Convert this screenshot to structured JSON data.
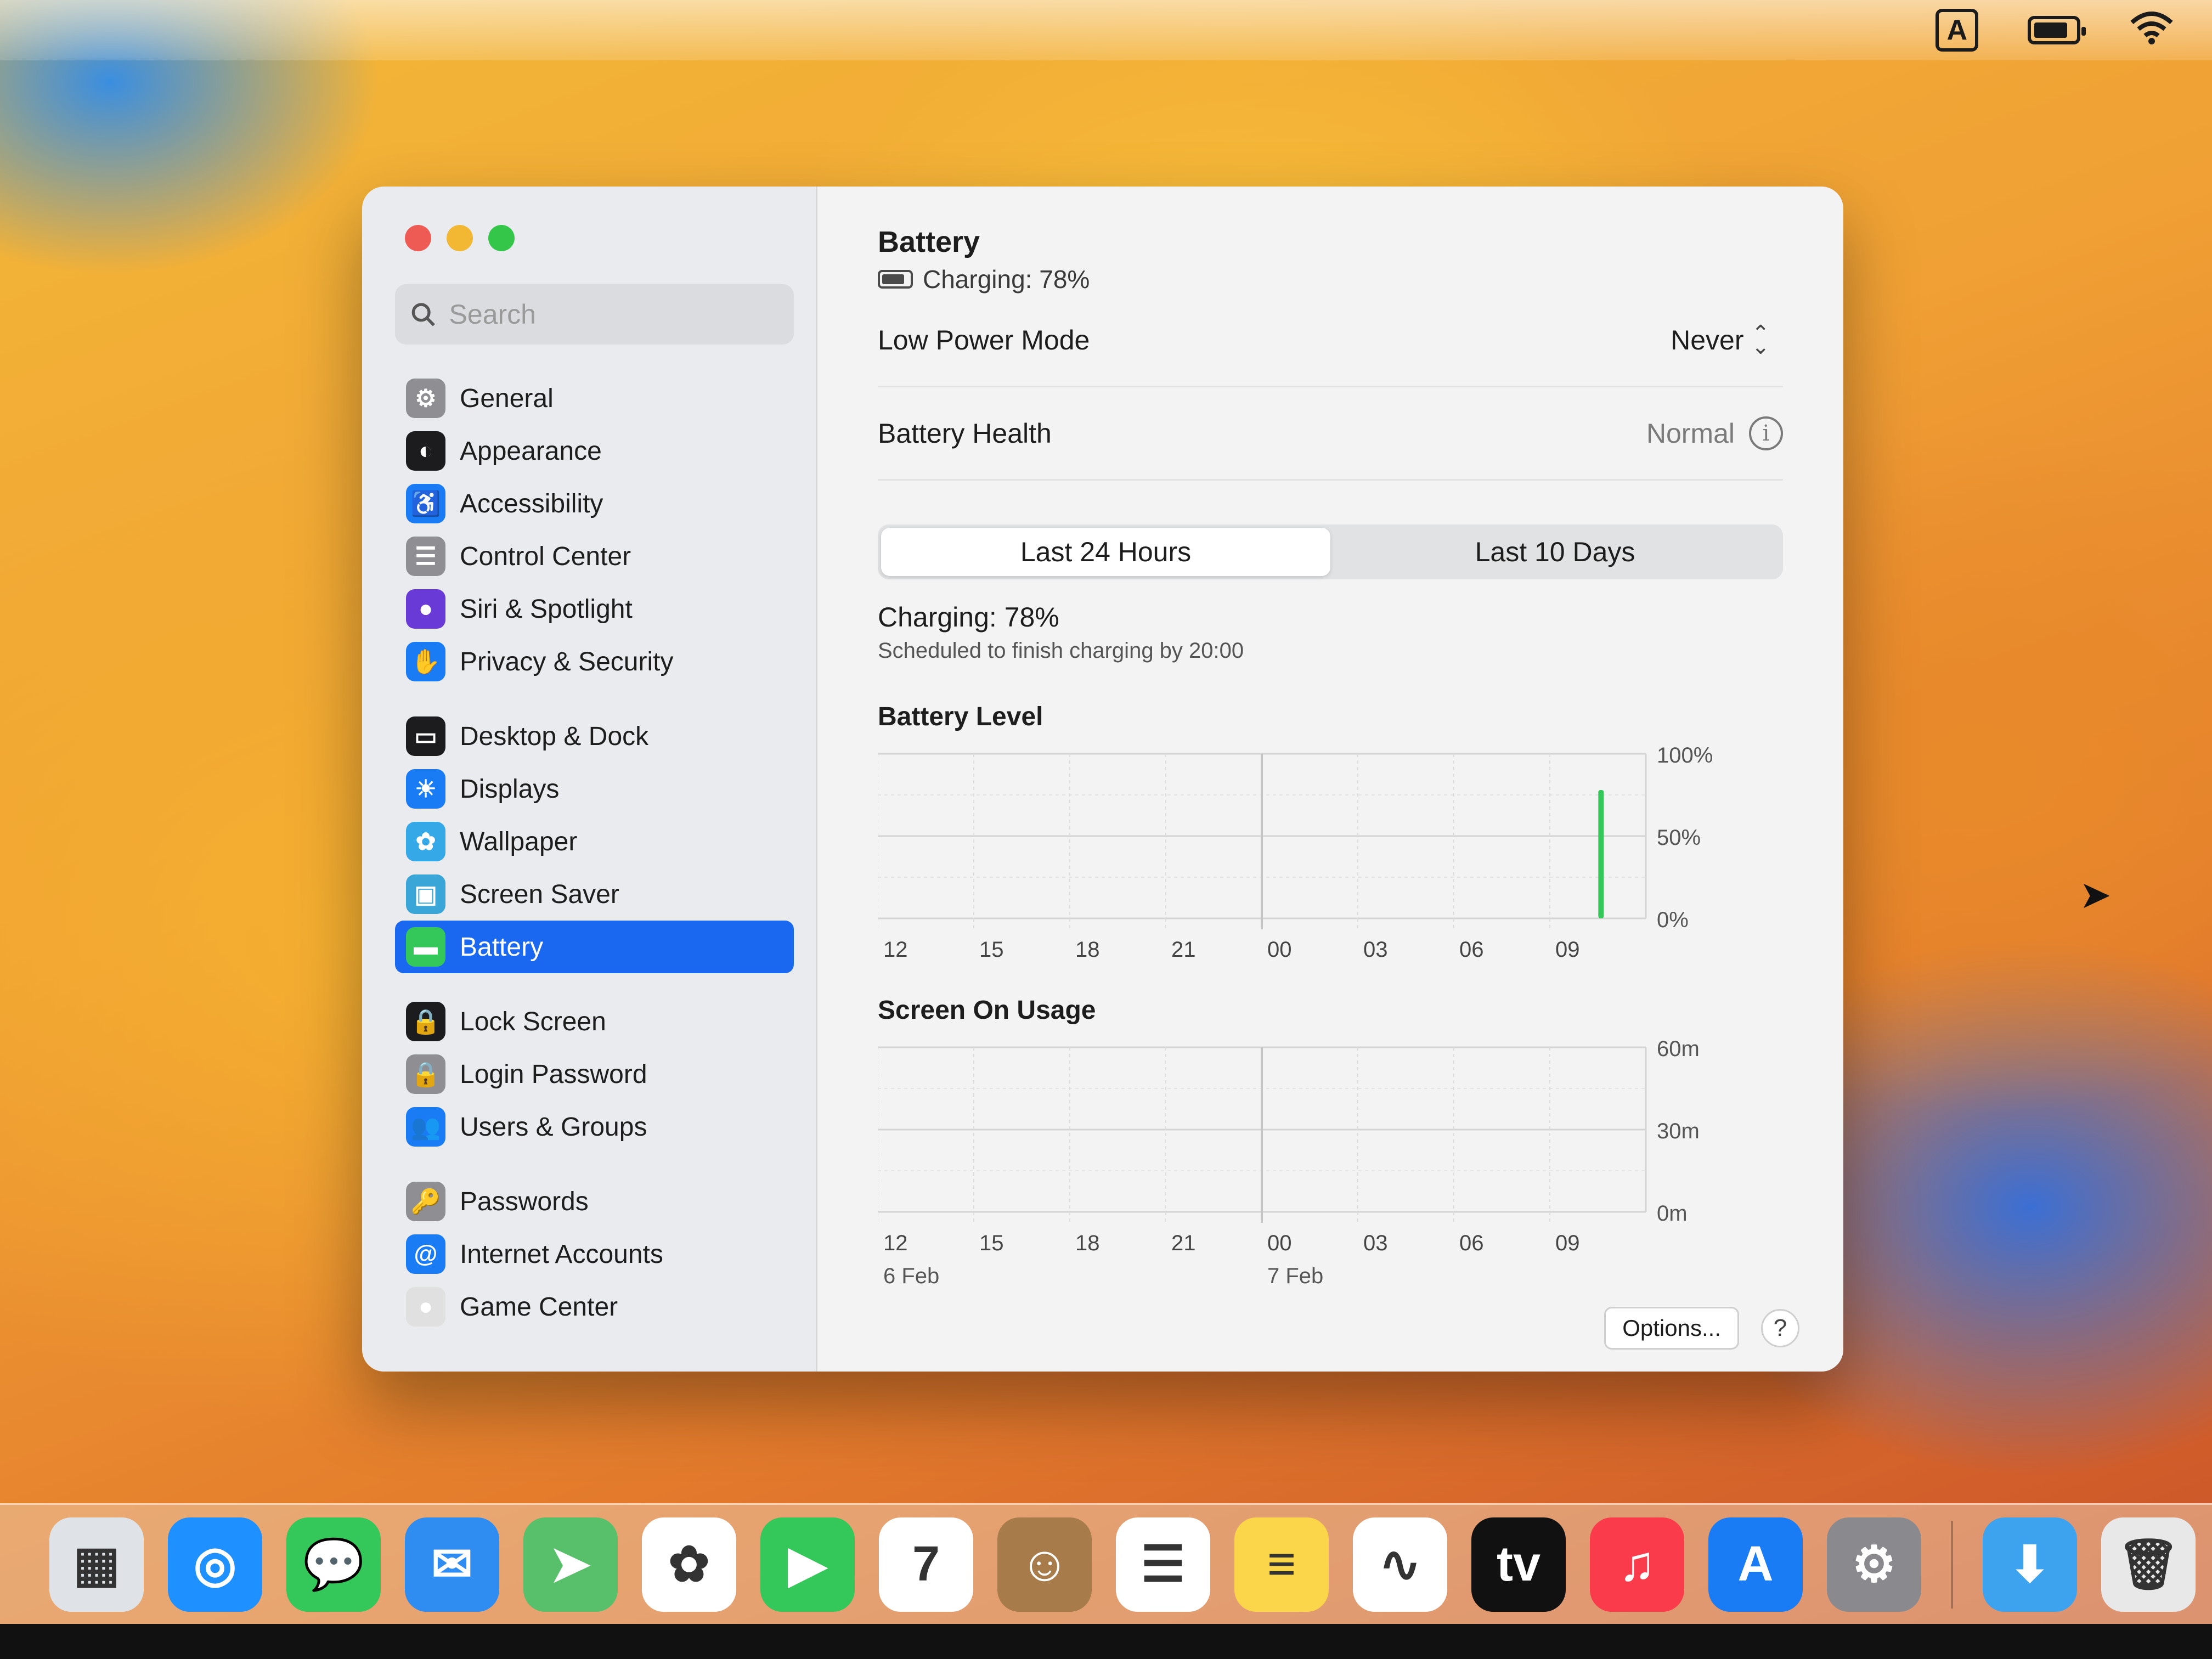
{
  "menubar": {
    "input_icon": "A"
  },
  "window": {
    "search_placeholder": "Search",
    "sidebar": {
      "groups": [
        [
          {
            "label": "General",
            "icon": "gear-icon",
            "color": "#8e8e93"
          },
          {
            "label": "Appearance",
            "icon": "appearance-icon",
            "color": "#1c1c1e"
          },
          {
            "label": "Accessibility",
            "icon": "accessibility-icon",
            "color": "#1a7cf5"
          },
          {
            "label": "Control Center",
            "icon": "control-center-icon",
            "color": "#8e8e93"
          },
          {
            "label": "Siri & Spotlight",
            "icon": "siri-icon",
            "color": "#6a3ad6"
          },
          {
            "label": "Privacy & Security",
            "icon": "hand-icon",
            "color": "#1a7cf5"
          }
        ],
        [
          {
            "label": "Desktop & Dock",
            "icon": "dock-icon",
            "color": "#1c1c1e"
          },
          {
            "label": "Displays",
            "icon": "sun-icon",
            "color": "#1a7cf5"
          },
          {
            "label": "Wallpaper",
            "icon": "flower-icon",
            "color": "#35a8e8"
          },
          {
            "label": "Screen Saver",
            "icon": "screensaver-icon",
            "color": "#3aa6d8"
          },
          {
            "label": "Battery",
            "icon": "battery-icon",
            "color": "#34c759"
          }
        ],
        [
          {
            "label": "Lock Screen",
            "icon": "lock-icon",
            "color": "#1c1c1e"
          },
          {
            "label": "Login Password",
            "icon": "lock-icon",
            "color": "#8e8e93"
          },
          {
            "label": "Users & Groups",
            "icon": "users-icon",
            "color": "#1a7cf5"
          }
        ],
        [
          {
            "label": "Passwords",
            "icon": "key-icon",
            "color": "#8e8e93"
          },
          {
            "label": "Internet Accounts",
            "icon": "at-icon",
            "color": "#1a7cf5"
          },
          {
            "label": "Game Center",
            "icon": "game-center-icon",
            "color": "#e0e0e0"
          }
        ]
      ],
      "active": "Battery"
    }
  },
  "main": {
    "title": "Battery",
    "status": "Charging: 78%",
    "low_power_label": "Low Power Mode",
    "low_power_value": "Never",
    "health_label": "Battery Health",
    "health_value": "Normal",
    "tabs": [
      "Last 24 Hours",
      "Last 10 Days"
    ],
    "active_tab": "Last 24 Hours",
    "charge_heading": "Charging: 78%",
    "charge_sub": "Scheduled to finish charging by 20:00",
    "options_label": "Options...",
    "help_label": "?"
  },
  "chart_data": [
    {
      "type": "bar",
      "title": "Battery Level",
      "categories": [
        "12",
        "15",
        "18",
        "21",
        "00",
        "03",
        "06",
        "09"
      ],
      "y_ticks": [
        "100%",
        "50%",
        "0%"
      ],
      "ylim": [
        0,
        100
      ],
      "bars": [
        {
          "x_hour": 10.6,
          "value": 78
        }
      ],
      "bar_color": "#34c759"
    },
    {
      "type": "bar",
      "title": "Screen On Usage",
      "categories": [
        "12",
        "15",
        "18",
        "21",
        "00",
        "03",
        "06",
        "09"
      ],
      "date_labels": [
        {
          "at": "12",
          "label": "6 Feb"
        },
        {
          "at": "00",
          "label": "7 Feb"
        }
      ],
      "y_ticks": [
        "60m",
        "30m",
        "0m"
      ],
      "ylim": [
        0,
        60
      ],
      "bars": []
    }
  ],
  "dock": {
    "apps": [
      {
        "name": "launchpad-icon",
        "color": "#dfe3e8",
        "glyph": "▦"
      },
      {
        "name": "safari-icon",
        "color": "#1e90ff",
        "glyph": "◎"
      },
      {
        "name": "messages-icon",
        "color": "#34c759",
        "glyph": "💬"
      },
      {
        "name": "mail-icon",
        "color": "#2f8cf0",
        "glyph": "✉"
      },
      {
        "name": "maps-icon",
        "color": "#58c06a",
        "glyph": "➤"
      },
      {
        "name": "photos-icon",
        "color": "#ffffff",
        "glyph": "✿"
      },
      {
        "name": "facetime-icon",
        "color": "#34c759",
        "glyph": "▶"
      },
      {
        "name": "calendar-icon",
        "color": "#ffffff",
        "glyph": "7"
      },
      {
        "name": "contacts-icon",
        "color": "#a77b4a",
        "glyph": "☺"
      },
      {
        "name": "reminders-icon",
        "color": "#ffffff",
        "glyph": "☰"
      },
      {
        "name": "notes-icon",
        "color": "#fbd54a",
        "glyph": "≡"
      },
      {
        "name": "freeform-icon",
        "color": "#ffffff",
        "glyph": "∿"
      },
      {
        "name": "tv-icon",
        "color": "#111111",
        "glyph": "tv"
      },
      {
        "name": "music-icon",
        "color": "#fa3b4c",
        "glyph": "♫"
      },
      {
        "name": "app-store-icon",
        "color": "#1a7cf5",
        "glyph": "A"
      },
      {
        "name": "system-settings-icon",
        "color": "#8a8a8e",
        "glyph": "⚙"
      }
    ],
    "right": [
      {
        "name": "downloads-folder-icon",
        "color": "#3ea3ef",
        "glyph": "⬇"
      },
      {
        "name": "trash-icon",
        "color": "#e8e8e8",
        "glyph": "🗑"
      }
    ]
  }
}
